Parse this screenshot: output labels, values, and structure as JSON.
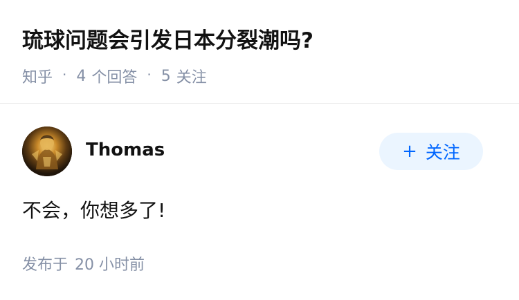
{
  "question": {
    "title": "琉球问题会引发日本分裂潮吗?",
    "source": "知乎",
    "separator": "·",
    "answer_count": "4",
    "answer_label": "个回答",
    "follower_count": "5",
    "follower_label": "关注"
  },
  "answer": {
    "author": {
      "name": "Thomas",
      "avatar_icon": "golden-figure-avatar"
    },
    "follow_button": {
      "plus": "+",
      "label": "关注"
    },
    "content": "不会，你想多了!",
    "meta": {
      "prefix": "发布于",
      "time": "20 小时前"
    }
  },
  "colors": {
    "text_primary": "#121212",
    "text_secondary": "#8590a6",
    "accent": "#0066ff",
    "follow_bg": "#ebf5ff",
    "divider": "#ececec"
  }
}
